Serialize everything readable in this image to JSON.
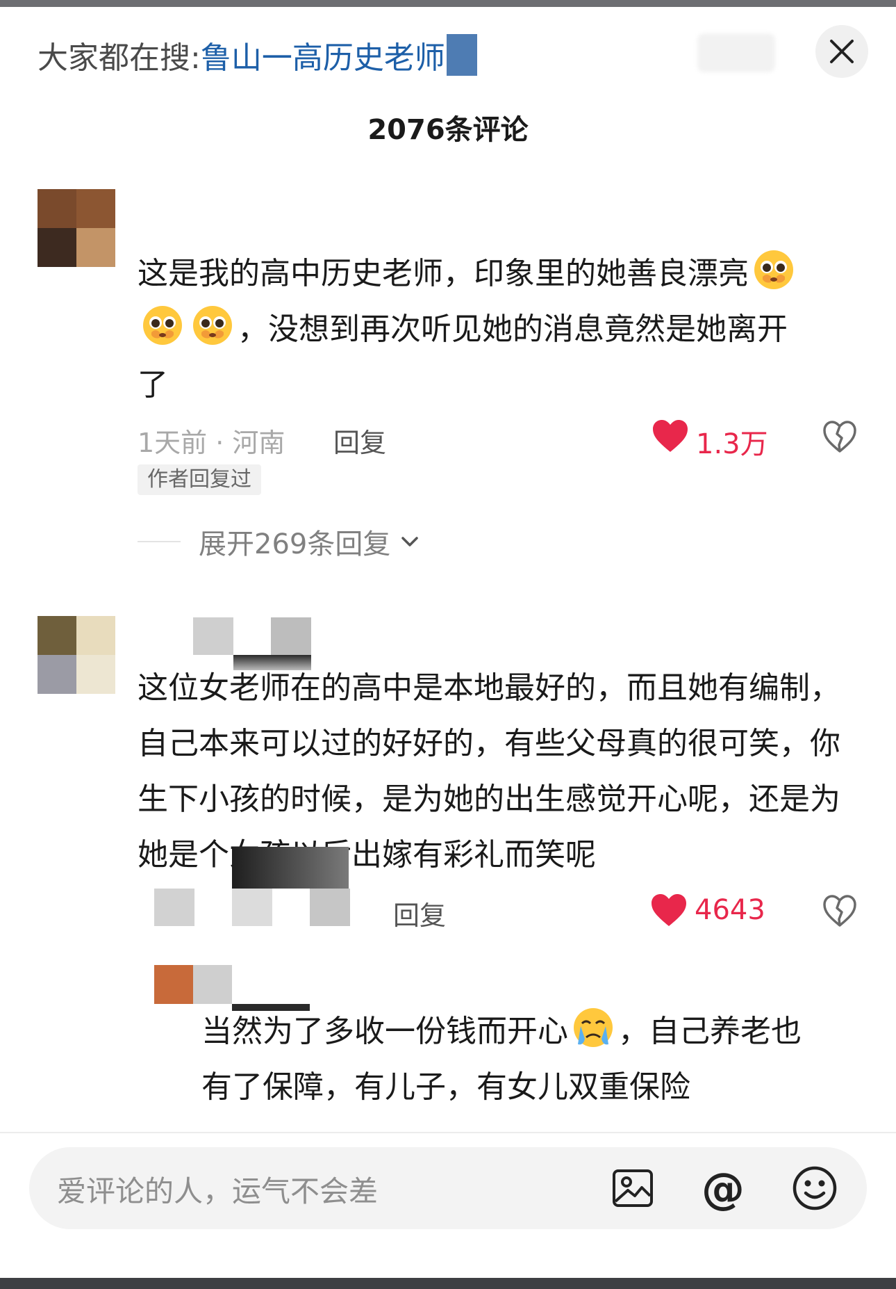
{
  "header": {
    "search_prefix": "大家都在搜:",
    "search_term": "鲁山一高历史老师",
    "close_icon": "close-icon",
    "comment_count": "2076条评论"
  },
  "comments": [
    {
      "text_line1": "这是我的高中历史老师，印象里的她善良漂亮",
      "text_line2": "，没想到再次听见她的消息竟然是她离开",
      "text_line3": "了",
      "emoji": "pleading-tearful-face",
      "time_location": "1天前 · 河南",
      "reply_label": "回复",
      "likes": "1.3万",
      "author_badge": "作者回复过",
      "expand_label": "展开269条回复"
    },
    {
      "text": "这位女老师在的高中是本地最好的，而且她有编制，自己本来可以过的好好的，有些父母真的很可笑，你生下小孩的时候，是为她的出生感觉开心呢，还是为她是个女孩以后出嫁有彩礼而笑呢",
      "reply_label": "回复",
      "likes": "4643"
    }
  ],
  "sub_reply": {
    "text_line1a": "当然为了多收一份钱而开心",
    "text_line1b": "，自己养老也",
    "text_line2": "有了保障，有儿子，有女儿双重保险",
    "emoji": "crying-face"
  },
  "input_bar": {
    "placeholder": "爱评论的人，运气不会差",
    "icons": [
      "image-icon",
      "at-icon",
      "emoji-icon"
    ],
    "at_glyph": "@"
  },
  "colors": {
    "accent_link": "#1d5fa8",
    "like_red": "#e8274b",
    "meta_gray": "#a8a8a8"
  }
}
